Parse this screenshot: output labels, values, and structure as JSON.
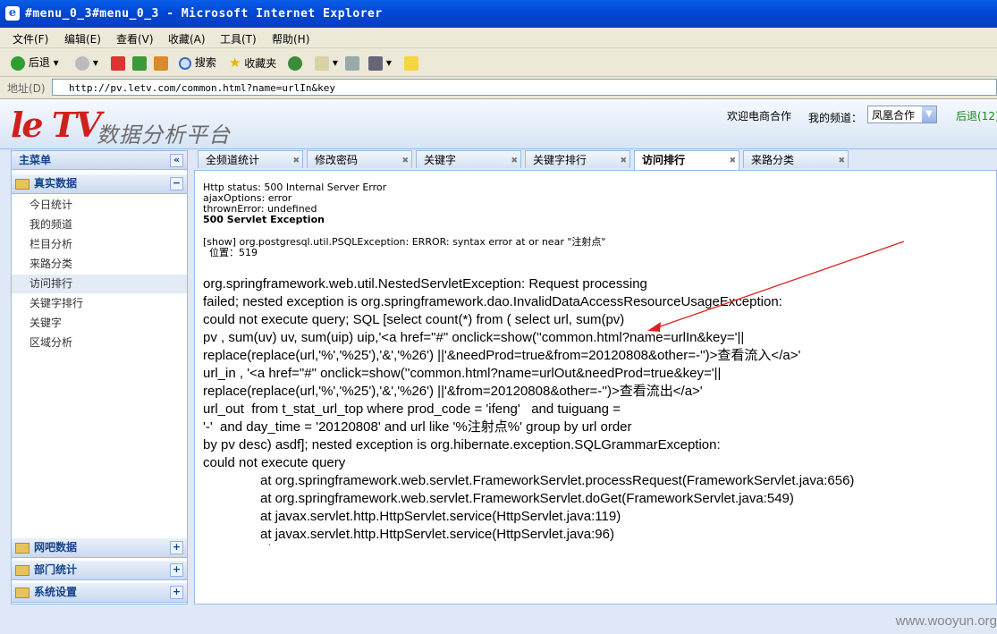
{
  "window": {
    "title": "#menu_0_3#menu_0_3 - Microsoft Internet Explorer"
  },
  "menubar": [
    "文件(F)",
    "编辑(E)",
    "查看(V)",
    "收藏(A)",
    "工具(T)",
    "帮助(H)"
  ],
  "toolbar": {
    "back": "后退",
    "search": "搜索",
    "favorites": "收藏夹"
  },
  "address": {
    "label": "地址(D)",
    "url": "http://pv.letv.com/common.html?name=urlIn&key"
  },
  "header": {
    "logo": "le TV",
    "subtitle": "数据分析平台",
    "link_ecommerce": "欢迎电商合作",
    "my_channel_label": "我的频道：",
    "channel_selected": "凤凰合作",
    "back_link": "后退(12)"
  },
  "sidebar": {
    "title": "主菜单",
    "section_real": "真实数据",
    "items": [
      "今日统计",
      "我的频道",
      "栏目分析",
      "来路分类",
      "访问排行",
      "关键字排行",
      "关键字",
      "区域分析"
    ],
    "selected_index": 4,
    "section_netbar": "网吧数据",
    "section_dept": "部门统计",
    "section_system": "系统设置"
  },
  "tabs": [
    {
      "label": "全频道统计"
    },
    {
      "label": "修改密码"
    },
    {
      "label": "关键字"
    },
    {
      "label": "关键字排行"
    },
    {
      "label": "访问排行",
      "active": true
    },
    {
      "label": "来路分类"
    }
  ],
  "error": {
    "status": "Http status: 500 Internal Server Error",
    "ajax": "ajaxOptions: error",
    "thrown": "thrownError: undefined",
    "heading": "500 Servlet Exception",
    "show": "[show] org.postgresql.util.PSQLException: ERROR: syntax error at or near \"注射点\"",
    "position": "  位置：519",
    "lines": [
      "org.springframework.web.util.NestedServletException: Request processing",
      "failed; nested exception is org.springframework.dao.InvalidDataAccessResourceUsageException:",
      "could not execute query; SQL [select count(*) from ( select url, sum(pv)",
      "pv , sum(uv) uv, sum(uip) uip,'<a href=\"#\" onclick=show(''common.html?name=urlIn&key='||",
      "replace(replace(url,'%','%25'),'&','%26') ||'&needProd=true&from=20120808&other=-'')>查看流入</a>'",
      "url_in , '<a href=\"#\" onclick=show(''common.html?name=urlOut&needProd=true&key='||",
      "replace(replace(url,'%','%25'),'&','%26') ||'&from=20120808&other=-'')>查看流出</a>'",
      "url_out  from t_stat_url_top where prod_code = 'ifeng'   and tuiguang =",
      "'-'  and day_time = '20120808' and url like '%注射点%' group by url order",
      "by pv desc) asdf]; nested exception is org.hibernate.exception.SQLGrammarException:",
      "could not execute query"
    ],
    "stack": [
      "at org.springframework.web.servlet.FrameworkServlet.processRequest(FrameworkServlet.java:656)",
      "at org.springframework.web.servlet.FrameworkServlet.doGet(FrameworkServlet.java:549)",
      "at javax.servlet.http.HttpServlet.service(HttpServlet.java:119)",
      "at javax.servlet.http.HttpServlet.service(HttpServlet.java:96)"
    ]
  },
  "footer": "www.wooyun.org",
  "colors": {
    "arrow": "#e02020",
    "titlebar": "#0a52d8",
    "panel_border": "#99bbe8"
  }
}
